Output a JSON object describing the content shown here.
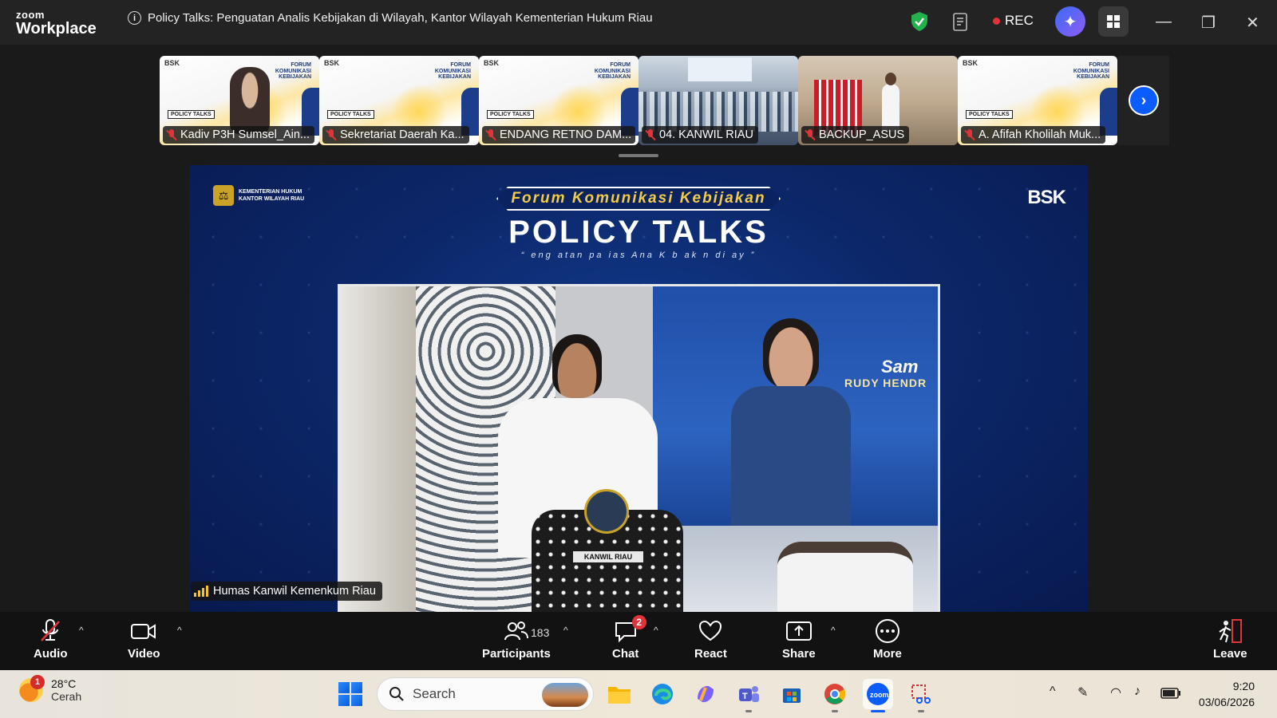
{
  "app": {
    "brand_top": "zoom",
    "brand_bottom": "Workplace",
    "meeting_title": "Policy Talks: Penguatan Analis Kebijakan di Wilayah, Kantor Wilayah Kementerian Hukum Riau",
    "rec_label": "REC"
  },
  "participants_strip": [
    {
      "name": "Kadiv P3H Sumsel_Ain...",
      "kind": "person",
      "muted": true
    },
    {
      "name": "Sekretariat Daerah Ka...",
      "kind": "slide",
      "muted": true
    },
    {
      "name": "ENDANG RETNO DAM...",
      "kind": "slide",
      "muted": true
    },
    {
      "name": "04. KANWIL RIAU",
      "kind": "room",
      "muted": true
    },
    {
      "name": "BACKUP_ASUS",
      "kind": "podium",
      "muted": true
    },
    {
      "name": "A. Afifah Kholilah Muk...",
      "kind": "slide",
      "muted": true
    }
  ],
  "thumb_slide": {
    "bsk": "BSK",
    "forum": "FORUM KOMUNIKASI KEBIJAKAN",
    "policy": "POLICY TALKS"
  },
  "main_video": {
    "kemen_line1": "KEMENTERIAN HUKUM",
    "kemen_line2": "KANTOR WILAYAH RIAU",
    "bsk_logo": "BSK",
    "forum_badge": "Forum Komunikasi Kebijakan",
    "headline": "POLICY TALKS",
    "subline": "“ eng atan  pa ias Ana  K b ak n di  ay ”",
    "screen_text_1": "Sam",
    "screen_text_2": "RUDY HENDR",
    "podium_plate": "KANWIL RIAU",
    "active_speaker": "Humas Kanwil Kemenkum Riau"
  },
  "toolbar": {
    "audio": "Audio",
    "video": "Video",
    "participants": "Participants",
    "participants_count": "183",
    "chat": "Chat",
    "chat_badge": "2",
    "react": "React",
    "share": "Share",
    "more": "More",
    "leave": "Leave"
  },
  "taskbar": {
    "weather_badge": "1",
    "temperature": "28°C",
    "condition": "Cerah",
    "search_placeholder": "Search",
    "time": "9:20",
    "date": "03/06/2026"
  },
  "colors": {
    "zoom_blue": "#0b5cff",
    "rec_red": "#e0343b",
    "toolbar_bg": "#121212",
    "slide_navy": "#0c2769"
  }
}
